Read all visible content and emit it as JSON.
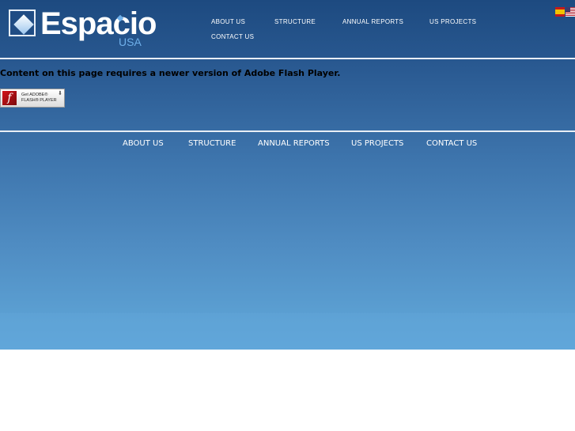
{
  "logo": {
    "word": "Espacio",
    "sub": "USA"
  },
  "top_nav": {
    "about": "ABOUT US",
    "structure": "STRUCTURE",
    "annual": "ANNUAL REPORTS",
    "projects": "US PROJECTS",
    "contact": "CONTACT US"
  },
  "languages": [
    {
      "code": "es",
      "icon": "spain-flag-icon"
    },
    {
      "code": "en",
      "icon": "us-flag-icon"
    }
  ],
  "flash": {
    "message": "Content on this page requires a newer version of Adobe Flash Player.",
    "badge_line1": "Get ADOBE®",
    "badge_line2": "FLASH® PLAYER",
    "badge_glyph": "f"
  },
  "bottom_nav": {
    "about": "ABOUT US",
    "structure": "STRUCTURE",
    "annual": "ANNUAL REPORTS",
    "projects": "US PROJECTS",
    "contact": "CONTACT US"
  },
  "colors": {
    "header_blue": "#1d4a80",
    "gradient_bottom": "#60a6d9",
    "logo_accent": "#6fb0ea",
    "text_white": "#ffffff"
  }
}
